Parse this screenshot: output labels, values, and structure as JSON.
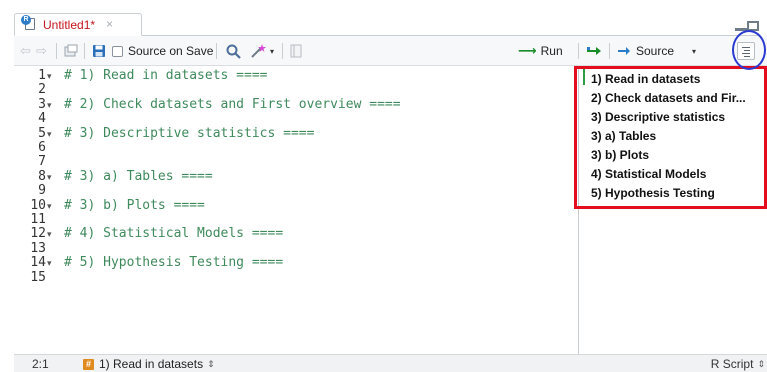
{
  "tab": {
    "title": "Untitled1*",
    "close": "×",
    "badge": "R"
  },
  "toolbar": {
    "back_arrow": "⇦",
    "forward_arrow": "⇨",
    "source_on_save_label": "Source on Save",
    "run_label": "Run",
    "source_label": "Source",
    "run_arrow": "⟶",
    "caret": "▾"
  },
  "editor": {
    "lines": [
      {
        "num": "1",
        "fold": "▾",
        "text": "# 1) Read in datasets ===="
      },
      {
        "num": "2",
        "fold": "",
        "text": ""
      },
      {
        "num": "3",
        "fold": "▾",
        "text": "# 2) Check datasets and First overview ===="
      },
      {
        "num": "4",
        "fold": "",
        "text": ""
      },
      {
        "num": "5",
        "fold": "▾",
        "text": "# 3) Descriptive statistics ===="
      },
      {
        "num": "6",
        "fold": "",
        "text": ""
      },
      {
        "num": "7",
        "fold": "",
        "text": ""
      },
      {
        "num": "8",
        "fold": "▾",
        "text": "# 3) a) Tables ===="
      },
      {
        "num": "9",
        "fold": "",
        "text": ""
      },
      {
        "num": "10",
        "fold": "▾",
        "text": "# 3) b) Plots ===="
      },
      {
        "num": "11",
        "fold": "",
        "text": ""
      },
      {
        "num": "12",
        "fold": "▾",
        "text": "# 4) Statistical Models ===="
      },
      {
        "num": "13",
        "fold": "",
        "text": ""
      },
      {
        "num": "14",
        "fold": "▾",
        "text": "# 5) Hypothesis Testing ===="
      },
      {
        "num": "15",
        "fold": "",
        "text": ""
      }
    ]
  },
  "outline": {
    "items": [
      "1) Read in datasets",
      "2) Check datasets and Fir...",
      "3) Descriptive statistics",
      "3) a) Tables",
      "3) b) Plots",
      "4) Statistical Models",
      "5) Hypothesis Testing"
    ]
  },
  "status": {
    "position": "2:1",
    "section_icon": "#",
    "section_label": "1) Read in datasets",
    "updown": "⇕",
    "language": "R Script"
  },
  "colors": {
    "code_comment": "#3f8a5c",
    "highlight_box": "#e40d1e",
    "annotation_circle": "#2b3bd1",
    "tab_title_modified": "#c4141c"
  }
}
